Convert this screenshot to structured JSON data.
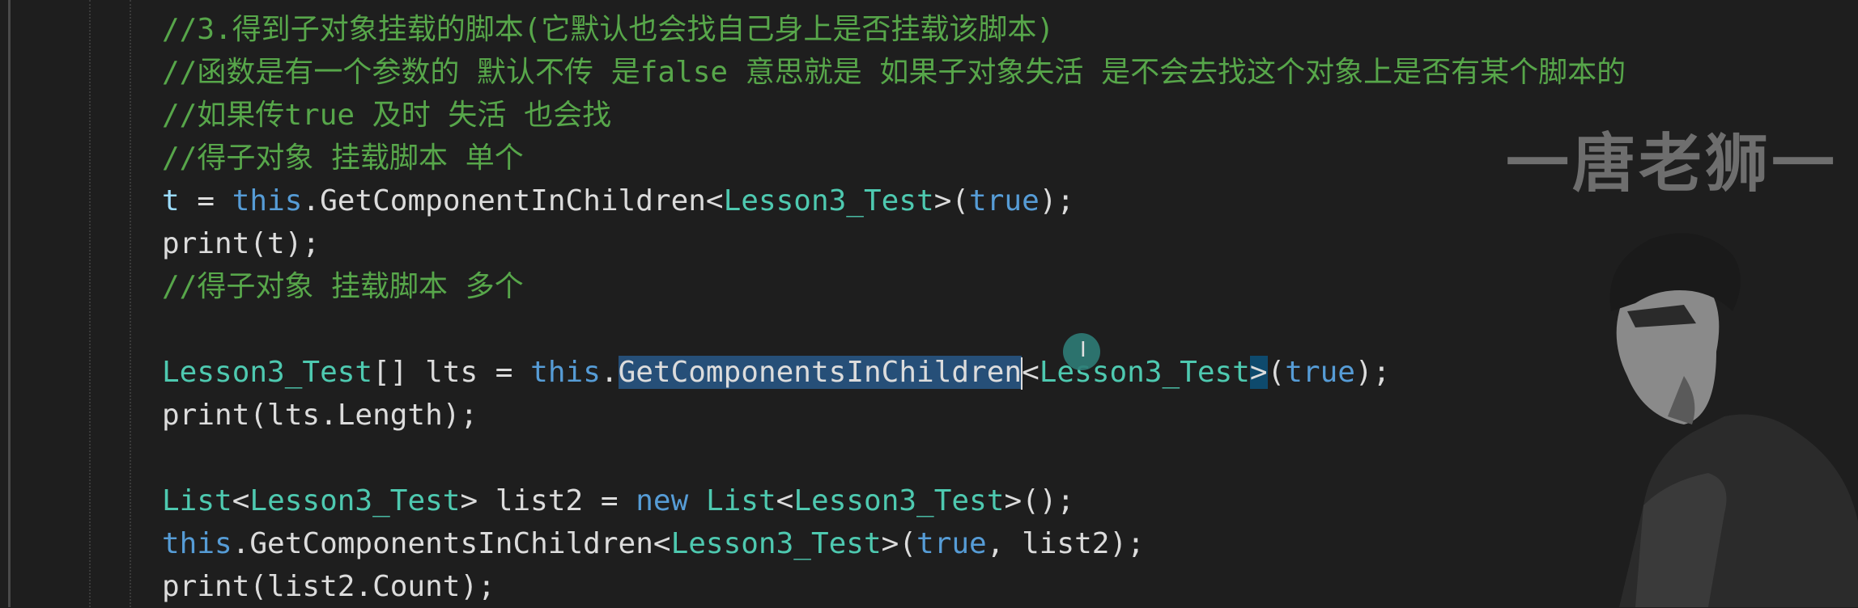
{
  "watermark": {
    "text": "一唐老狮一"
  },
  "code_lines": {
    "l1": "//3.得到子对象挂载的脚本(它默认也会找自己身上是否挂载该脚本)",
    "l2": "//函数是有一个参数的 默认不传 是false 意思就是 如果子对象失活 是不会去找这个对象上是否有某个脚本的",
    "l3": "//如果传true 及时 失活 也会找",
    "l4": "//得子对象 挂载脚本 单个",
    "l5": {
      "a": "t",
      "b": " = ",
      "c": "this",
      "d": ".GetComponentInChildren<",
      "e": "Lesson3_Test",
      "f": ">(",
      "g": "true",
      "h": ");"
    },
    "l6": "print(t);",
    "l7": "//得子对象 挂载脚本 多个",
    "l9": {
      "a": "Lesson3_Test",
      "b": "[] lts = ",
      "c": "this",
      "d": ".",
      "e": "GetComponentsInChildren",
      "f": "<",
      "g": "Lesson3_Test",
      "h": ">",
      "i": "(",
      "j": "true",
      "k": ");"
    },
    "l10": "print(lts.Length);",
    "l12": {
      "a": "List",
      "b": "<",
      "c": "Lesson3_Test",
      "d": "> list2 = ",
      "e": "new",
      "f": " ",
      "g": "List",
      "h": "<",
      "i": "Lesson3_Test",
      "j": ">();"
    },
    "l13": {
      "a": "this",
      "b": ".GetComponentsInChildren<",
      "c": "Lesson3_Test",
      "d": ">(",
      "e": "true",
      "f": ", list2);"
    },
    "l14": "print(list2.Count);"
  },
  "colors": {
    "background": "#1e1e1e",
    "comment": "#57a64a",
    "keyword": "#569cd6",
    "type": "#4ec9b0",
    "selection": "#264f78"
  },
  "icons": {
    "cursor": "text-cursor-icon",
    "avatar": "presenter-avatar"
  }
}
